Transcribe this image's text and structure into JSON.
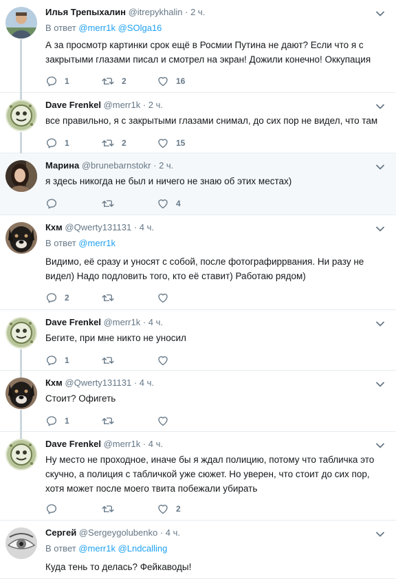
{
  "colors": {
    "link": "#1da1f2",
    "muted": "#657786",
    "divider": "#e6ecf0",
    "highlight_bg": "#f5f8fa",
    "thread_line": "#ccd6dd"
  },
  "icons": {
    "reply": "reply-icon",
    "retweet": "retweet-icon",
    "like": "heart-icon",
    "more": "chevron-down-icon"
  },
  "reply_prefix": "В ответ",
  "tweets": [
    {
      "name": "Илья Трепыхалин",
      "handle": "@itrepykhalin",
      "time": "2 ч.",
      "reply_to": [
        "@merr1k",
        "@SOlga16"
      ],
      "text": "А за просмотр картинки срок ещё в Росмии Путина не дают? Если что я с закрытыми глазами писал и смотрел на экран! Дожили конечно! Оккупация",
      "replies": "1",
      "retweets": "2",
      "likes": "16"
    },
    {
      "name": "Dave Frenkel",
      "handle": "@merr1k",
      "time": "2 ч.",
      "text": "все правильно, я с закрытыми глазами снимал, до сих пор не видел, что там",
      "replies": "1",
      "retweets": "2",
      "likes": "15"
    },
    {
      "name": "Марина",
      "handle": "@brunebarnstokr",
      "time": "2 ч.",
      "text": "я здесь никогда не был и ничего не знаю об этих местах)",
      "replies": "",
      "retweets": "",
      "likes": "4"
    },
    {
      "name": "Кхм",
      "handle": "@Qwerty131131",
      "time": "4 ч.",
      "reply_to": [
        "@merr1k"
      ],
      "text": "Видимо, её сразу и уносят с собой, после фотографиррвания. Ни разу не видел) Надо подловить того, кто её ставит) Работаю рядом)",
      "replies": "2",
      "retweets": "",
      "likes": ""
    },
    {
      "name": "Dave Frenkel",
      "handle": "@merr1k",
      "time": "4 ч.",
      "text": "Бегите, при мне никто не уносил",
      "replies": "1",
      "retweets": "",
      "likes": ""
    },
    {
      "name": "Кхм",
      "handle": "@Qwerty131131",
      "time": "4 ч.",
      "text": "Стоит? Офигеть",
      "replies": "1",
      "retweets": "",
      "likes": ""
    },
    {
      "name": "Dave Frenkel",
      "handle": "@merr1k",
      "time": "4 ч.",
      "text": "Ну место не проходное, иначе бы я ждал полицию, потому что табличка это скучно, а полиция с табличкой уже сюжет. Но уверен, что стоит до сих пор, хотя может после моего твита побежали убирать",
      "replies": "",
      "retweets": "",
      "likes": "2"
    },
    {
      "name": "Сергей",
      "handle": "@Sergeygolubenko",
      "time": "4 ч.",
      "reply_to": [
        "@merr1k",
        "@Lndcalling"
      ],
      "text": "Куда тень то делась? Фейкаводы!",
      "replies": "",
      "retweets": "",
      "likes": ""
    }
  ]
}
